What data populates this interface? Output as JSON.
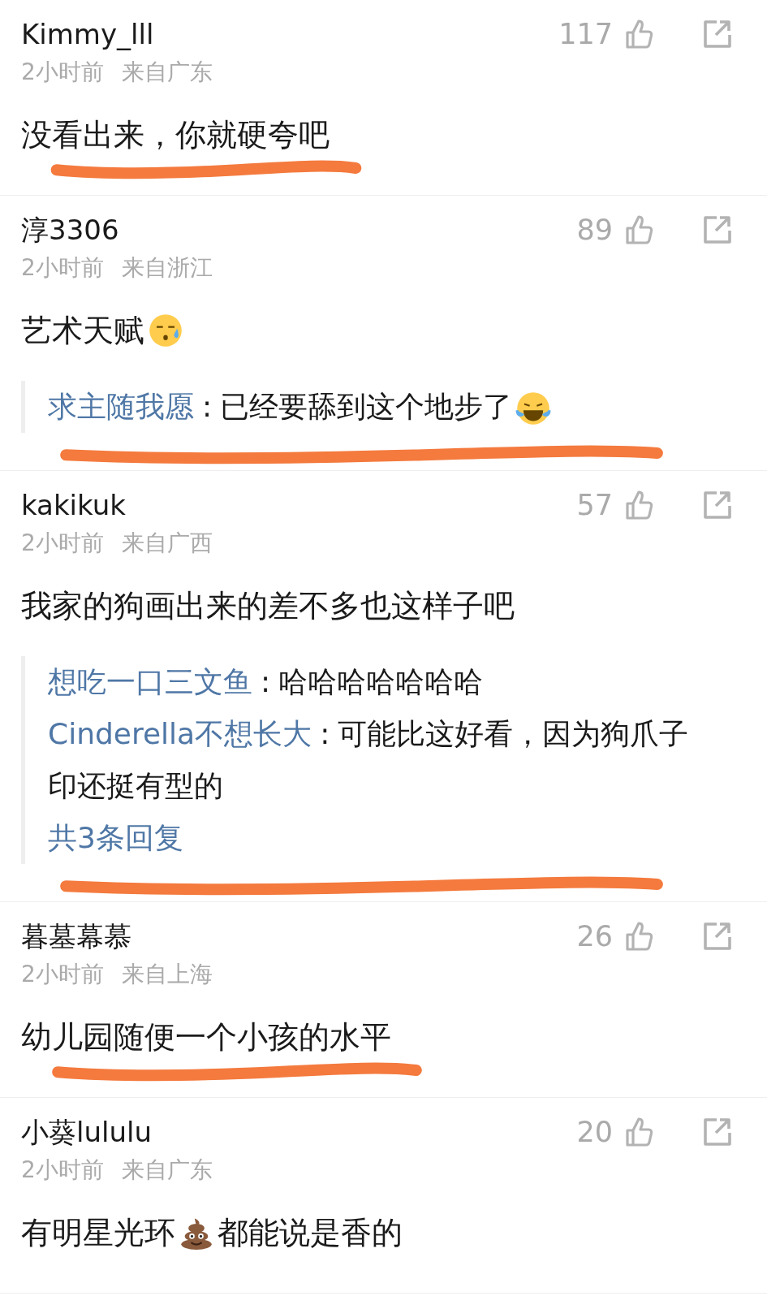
{
  "comments": [
    {
      "author": "Kimmy_lll",
      "count": "117",
      "time": "2小时前",
      "place": "来自广东",
      "content": [
        {
          "kind": "text",
          "text": "没看出来，你就硬夸吧"
        }
      ],
      "marked": true
    },
    {
      "author": "淳3306",
      "count": "89",
      "time": "2小时前",
      "place": "来自浙江",
      "content": [
        {
          "kind": "text",
          "text": "艺术天赋"
        },
        {
          "kind": "sweat-emoji"
        }
      ],
      "marked": false,
      "replies": {
        "marked": true,
        "items": [
          {
            "author": "求主随我愿",
            "sep": ":",
            "text": [
              {
                "kind": "text",
                "text": "已经要舔到这个地步了"
              },
              {
                "kind": "laugh-emoji"
              }
            ]
          }
        ]
      }
    },
    {
      "author": "kakikuk",
      "count": "57",
      "time": "2小时前",
      "place": "来自广西",
      "content": [
        {
          "kind": "text",
          "text": "我家的狗画出来的差不多也这样子吧"
        }
      ],
      "marked": false,
      "replies": {
        "marked": true,
        "items": [
          {
            "author": "想吃一口三文鱼",
            "sep": ":",
            "text": [
              {
                "kind": "text",
                "text": "哈哈哈哈哈哈哈"
              }
            ]
          },
          {
            "author": "Cinderella不想长大",
            "sep": ":",
            "text": [
              {
                "kind": "text",
                "text": "可能比这好看，因为狗爪子印还挺有型的"
              }
            ]
          }
        ],
        "more": "共3条回复"
      }
    },
    {
      "author": "暮墓幕慕",
      "count": "26",
      "time": "2小时前",
      "place": "来自上海",
      "content": [
        {
          "kind": "text",
          "text": "幼儿园随便一个小孩的水平"
        }
      ],
      "marked": true
    },
    {
      "author": "小葵lululu",
      "count": "20",
      "time": "2小时前",
      "place": "来自广东",
      "content": [
        {
          "kind": "text",
          "text": "有明星光环"
        },
        {
          "kind": "poop-emoji"
        },
        {
          "kind": "text",
          "text": "都能说是香的"
        }
      ],
      "marked": false
    }
  ]
}
